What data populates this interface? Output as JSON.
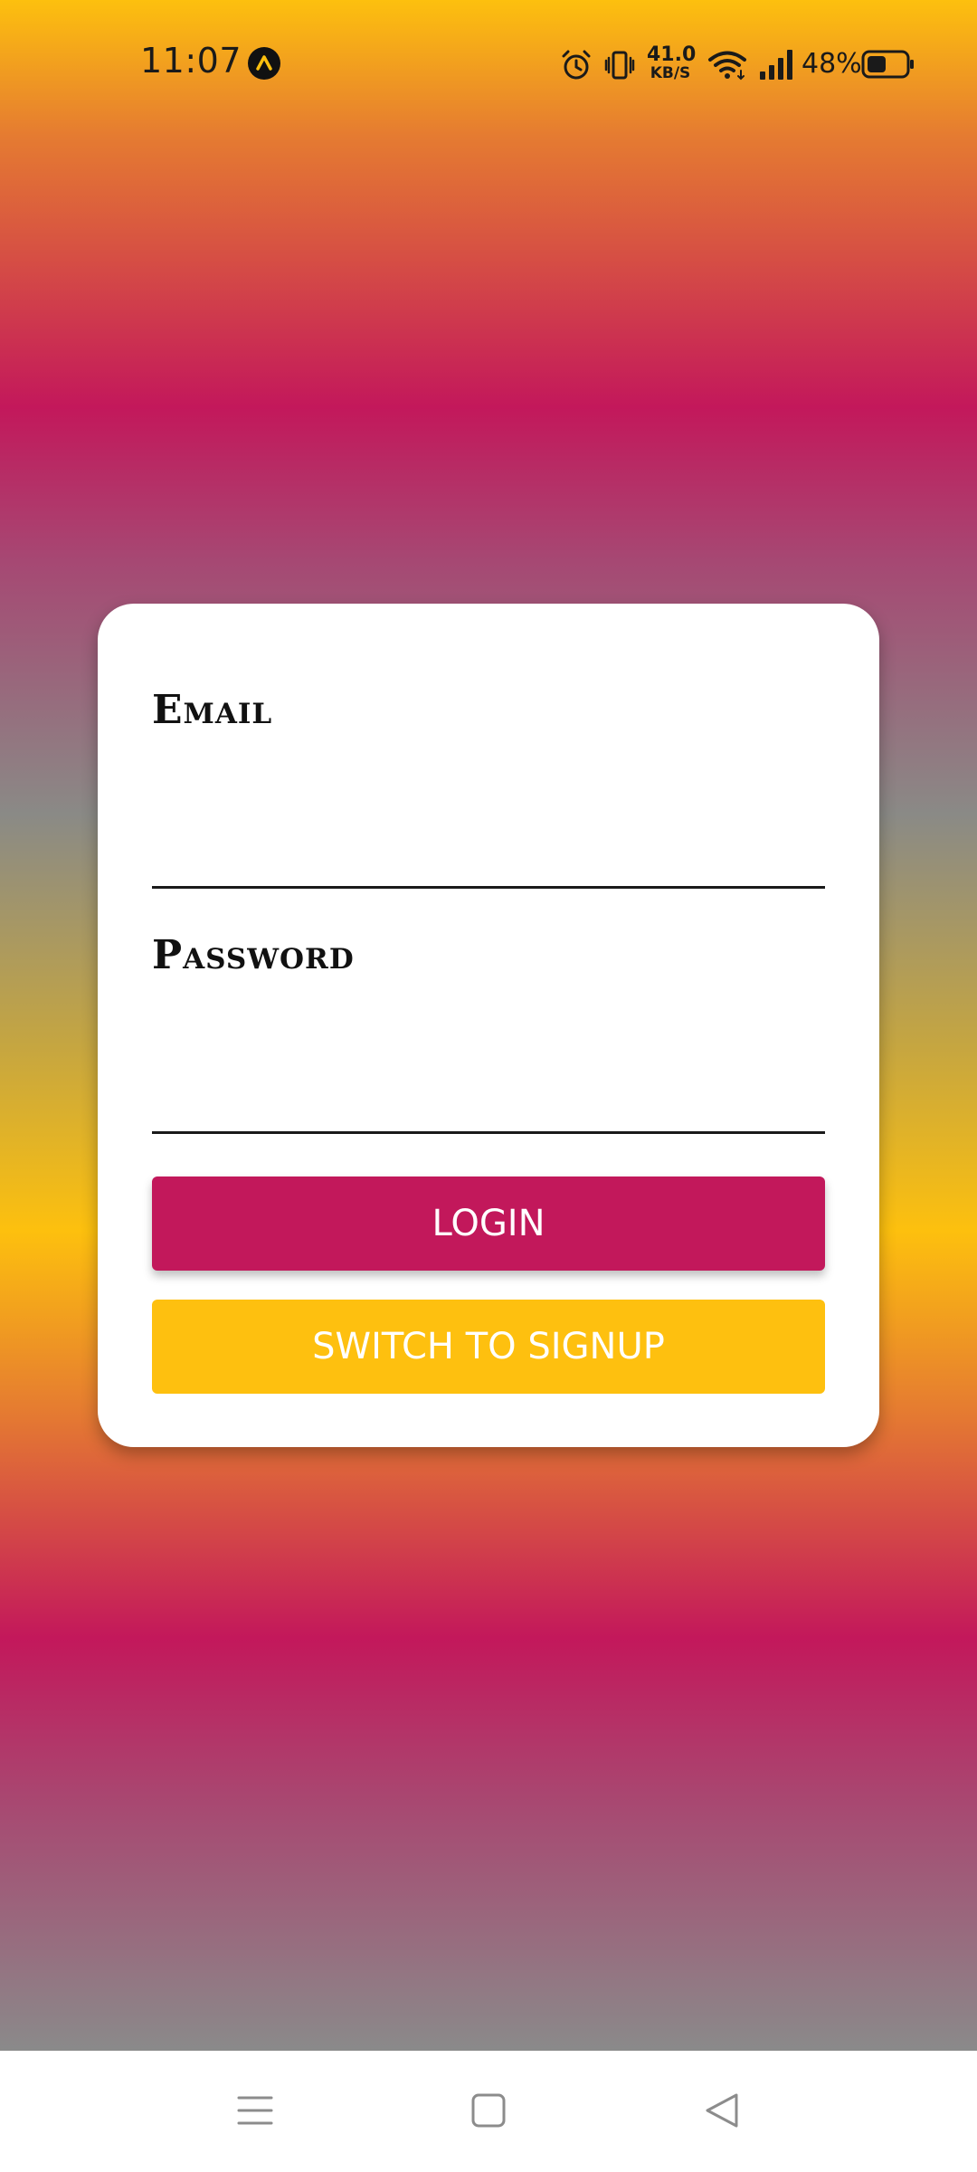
{
  "status_bar": {
    "time": "11:07",
    "network_speed_value": "41.0",
    "network_speed_unit": "KB/S",
    "battery_percent": "48%",
    "icons": [
      "expo-go-icon",
      "alarm-icon",
      "vibrate-icon",
      "wifi-icon",
      "signal-icon",
      "battery-icon"
    ]
  },
  "login_form": {
    "email_label": "Email",
    "email_value": "",
    "password_label": "Password",
    "password_value": "",
    "login_button_label": "LOGIN",
    "switch_button_label": "SWITCH TO SIGNUP"
  },
  "navigation_bar": {
    "icons": [
      "menu-icon",
      "home-icon",
      "back-icon"
    ]
  },
  "colors": {
    "accent_pink": "#c2185b",
    "accent_amber": "#fec00f",
    "card_background": "#ffffff",
    "gradient_grey": "#8a8a8a"
  }
}
